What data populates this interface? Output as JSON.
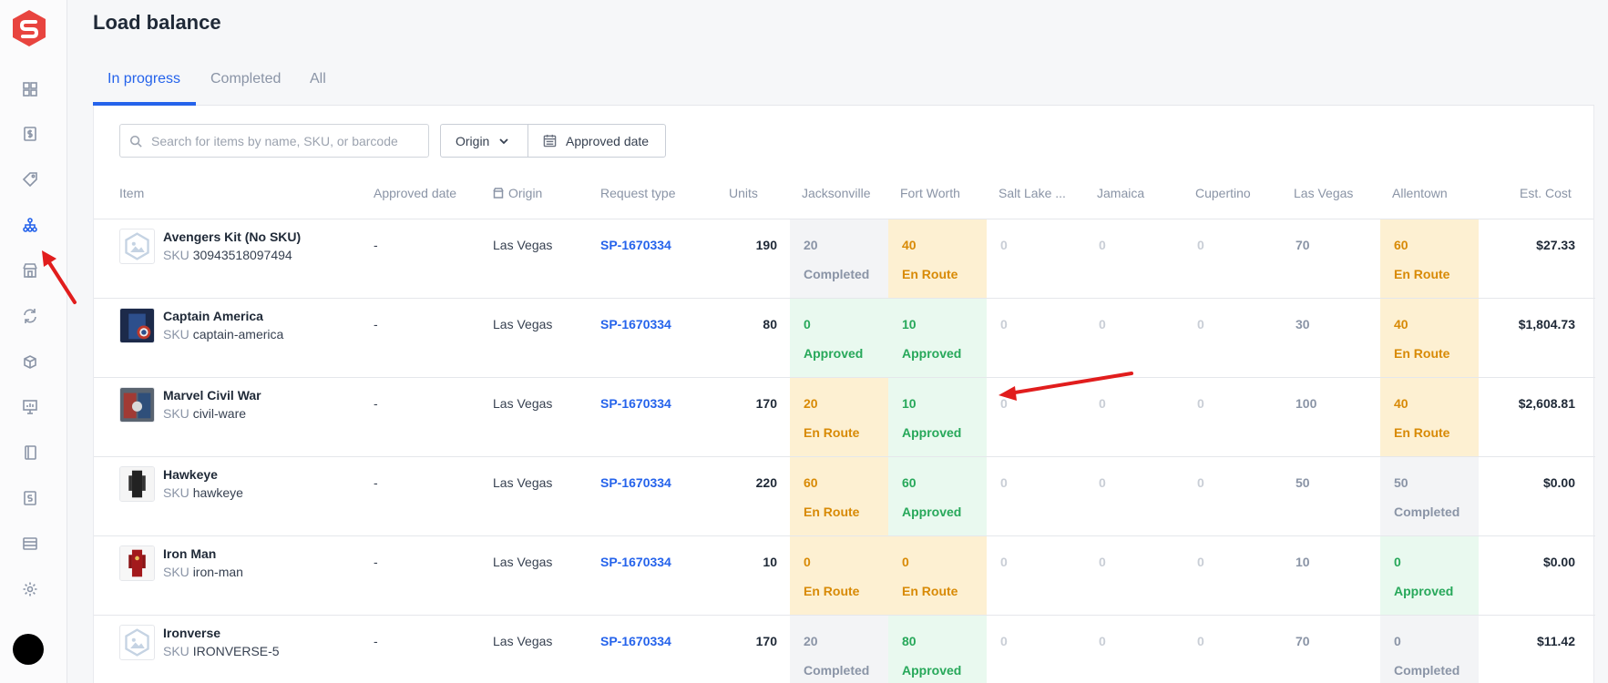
{
  "page": {
    "title": "Load balance"
  },
  "sidebar": {
    "items": [
      {
        "icon": "dashboard-icon"
      },
      {
        "icon": "dollar-doc-icon"
      },
      {
        "icon": "tag-icon"
      },
      {
        "icon": "hierarchy-icon",
        "active": true
      },
      {
        "icon": "store-icon"
      },
      {
        "icon": "sync-icon"
      },
      {
        "icon": "box-icon"
      },
      {
        "icon": "presentation-icon"
      },
      {
        "icon": "book-icon"
      },
      {
        "icon": "invoice-icon"
      },
      {
        "icon": "warehouse-icon"
      },
      {
        "icon": "gear-icon"
      }
    ]
  },
  "tabs": [
    {
      "label": "In progress",
      "active": true
    },
    {
      "label": "Completed"
    },
    {
      "label": "All"
    }
  ],
  "filters": {
    "search_placeholder": "Search for items by name, SKU, or barcode",
    "origin_label": "Origin",
    "date_label": "Approved date"
  },
  "table": {
    "columns": {
      "item": "Item",
      "approved_date": "Approved date",
      "origin": "Origin",
      "request_type": "Request type",
      "units": "Units",
      "locations": [
        "Jacksonville",
        "Fort Worth",
        "Salt Lake ...",
        "Jamaica",
        "Cupertino",
        "Las Vegas",
        "Allentown"
      ],
      "est_cost": "Est. Cost"
    },
    "sku_label": "SKU",
    "rows": [
      {
        "name": "Avengers Kit (No SKU)",
        "sku": "30943518097494",
        "thumb": "placeholder-image-icon",
        "approved_date": "-",
        "origin": "Las Vegas",
        "request": "SP-1670334",
        "units": "190",
        "locs": [
          {
            "q": "20",
            "status": "Completed",
            "kind": "completed"
          },
          {
            "q": "40",
            "status": "En Route",
            "kind": "enroute"
          },
          {
            "q": "0",
            "kind": "none"
          },
          {
            "q": "0",
            "kind": "none"
          },
          {
            "q": "0",
            "kind": "none"
          },
          {
            "q": "70",
            "kind": "plain"
          },
          {
            "q": "60",
            "status": "En Route",
            "kind": "enroute"
          }
        ],
        "cost": "$27.33"
      },
      {
        "name": "Captain America",
        "sku": "captain-america",
        "thumb": "captain-america-photo",
        "approved_date": "-",
        "origin": "Las Vegas",
        "request": "SP-1670334",
        "units": "80",
        "locs": [
          {
            "q": "0",
            "status": "Approved",
            "kind": "approved"
          },
          {
            "q": "10",
            "status": "Approved",
            "kind": "approved"
          },
          {
            "q": "0",
            "kind": "none"
          },
          {
            "q": "0",
            "kind": "none"
          },
          {
            "q": "0",
            "kind": "none"
          },
          {
            "q": "30",
            "kind": "plain"
          },
          {
            "q": "40",
            "status": "En Route",
            "kind": "enroute"
          }
        ],
        "cost": "$1,804.73"
      },
      {
        "name": "Marvel Civil War",
        "sku": "civil-ware",
        "thumb": "civil-war-photo",
        "approved_date": "-",
        "origin": "Las Vegas",
        "request": "SP-1670334",
        "units": "170",
        "locs": [
          {
            "q": "20",
            "status": "En Route",
            "kind": "enroute"
          },
          {
            "q": "10",
            "status": "Approved",
            "kind": "approved"
          },
          {
            "q": "0",
            "kind": "none"
          },
          {
            "q": "0",
            "kind": "none"
          },
          {
            "q": "0",
            "kind": "none"
          },
          {
            "q": "100",
            "kind": "plain"
          },
          {
            "q": "40",
            "status": "En Route",
            "kind": "enroute"
          }
        ],
        "cost": "$2,608.81"
      },
      {
        "name": "Hawkeye",
        "sku": "hawkeye",
        "thumb": "hawkeye-photo",
        "approved_date": "-",
        "origin": "Las Vegas",
        "request": "SP-1670334",
        "units": "220",
        "locs": [
          {
            "q": "60",
            "status": "En Route",
            "kind": "enroute"
          },
          {
            "q": "60",
            "status": "Approved",
            "kind": "approved"
          },
          {
            "q": "0",
            "kind": "none"
          },
          {
            "q": "0",
            "kind": "none"
          },
          {
            "q": "0",
            "kind": "none"
          },
          {
            "q": "50",
            "kind": "plain"
          },
          {
            "q": "50",
            "status": "Completed",
            "kind": "completed"
          }
        ],
        "cost": "$0.00"
      },
      {
        "name": "Iron Man",
        "sku": "iron-man",
        "thumb": "iron-man-photo",
        "approved_date": "-",
        "origin": "Las Vegas",
        "request": "SP-1670334",
        "units": "10",
        "locs": [
          {
            "q": "0",
            "status": "En Route",
            "kind": "enroute"
          },
          {
            "q": "0",
            "status": "En Route",
            "kind": "enroute"
          },
          {
            "q": "0",
            "kind": "none"
          },
          {
            "q": "0",
            "kind": "none"
          },
          {
            "q": "0",
            "kind": "none"
          },
          {
            "q": "10",
            "kind": "plain"
          },
          {
            "q": "0",
            "status": "Approved",
            "kind": "approved"
          }
        ],
        "cost": "$0.00"
      },
      {
        "name": "Ironverse",
        "sku": "IRONVERSE-5",
        "thumb": "placeholder-image-icon",
        "approved_date": "-",
        "origin": "Las Vegas",
        "request": "SP-1670334",
        "units": "170",
        "locs": [
          {
            "q": "20",
            "status": "Completed",
            "kind": "completed"
          },
          {
            "q": "80",
            "status": "Approved",
            "kind": "approved"
          },
          {
            "q": "0",
            "kind": "none"
          },
          {
            "q": "0",
            "kind": "none"
          },
          {
            "q": "0",
            "kind": "none"
          },
          {
            "q": "70",
            "kind": "plain"
          },
          {
            "q": "0",
            "status": "Completed",
            "kind": "completed"
          }
        ],
        "cost": "$11.42"
      }
    ]
  },
  "colors": {
    "accent": "#2563eb",
    "brand": "#e8443f",
    "enroute_bg": "#fdf0d2",
    "enroute_text": "#d88a06",
    "approved_bg": "#e9f9ef",
    "approved_text": "#27a85a",
    "completed_bg": "#f3f4f6",
    "annotation_arrow": "#e11d1d"
  }
}
